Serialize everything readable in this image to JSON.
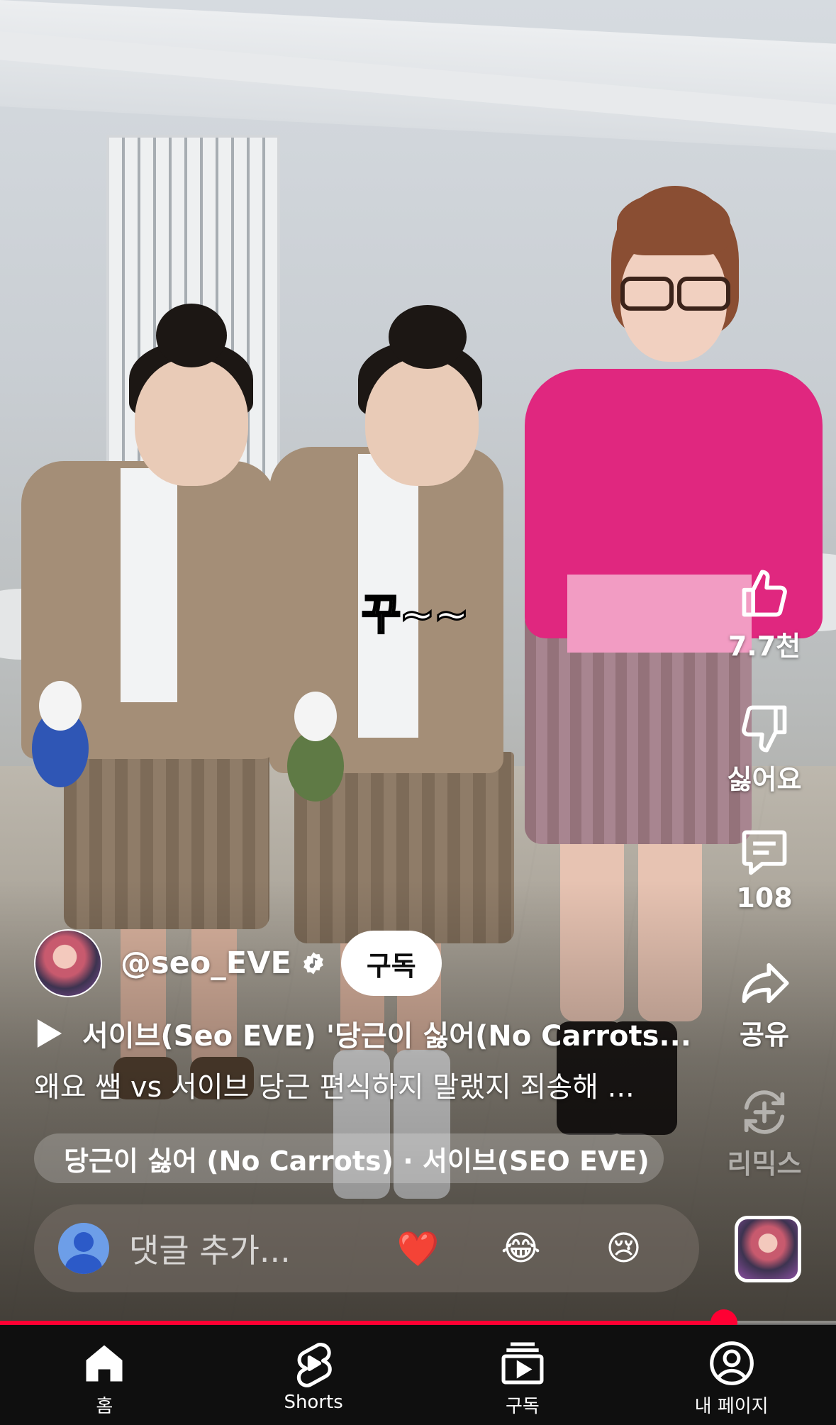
{
  "video": {
    "overlay_caption": "꾸~~"
  },
  "actions": {
    "like": {
      "label": "7.7천",
      "icon": "thumbs-up-icon"
    },
    "dislike": {
      "label": "싫어요",
      "icon": "thumbs-down-icon"
    },
    "comments": {
      "label": "108",
      "icon": "comment-icon"
    },
    "share": {
      "label": "공유",
      "icon": "share-icon"
    },
    "remix": {
      "label": "리믹스",
      "icon": "remix-icon"
    }
  },
  "channel": {
    "handle": "@seo_EVE",
    "subscribe_label": "구독"
  },
  "video_info": {
    "title": "서이브(Seo EVE) '당근이 싫어(No Carrots...",
    "description": "왜요 쌤 vs 서이브 당근 편식하지 말랬지 죄송해 ..."
  },
  "music": {
    "label": "당근이 싫어 (No Carrots) · 서이브(SEO EVE)"
  },
  "comment_bar": {
    "placeholder": "댓글 추가...",
    "emojis": [
      "❤️",
      "😂",
      "😢"
    ]
  },
  "progress": {
    "fraction": 0.866
  },
  "bottom_nav": [
    {
      "label": "홈",
      "icon": "home-icon"
    },
    {
      "label": "Shorts",
      "icon": "shorts-icon"
    },
    {
      "label": "구독",
      "icon": "subscriptions-icon"
    },
    {
      "label": "내 페이지",
      "icon": "profile-icon"
    }
  ],
  "colors": {
    "accent": "#ff0033",
    "nav_bg": "#0f0f0f"
  }
}
